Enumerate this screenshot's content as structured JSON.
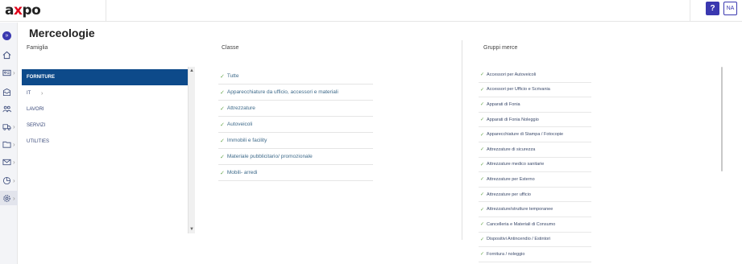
{
  "header": {
    "logo_a": "a",
    "logo_x": "x",
    "logo_po": "po",
    "help_label": "?",
    "user_initials": "NA"
  },
  "page": {
    "title": "Merceologie"
  },
  "columns": {
    "famiglia": "Famiglia",
    "classe": "Classe",
    "gruppi": "Gruppi merce"
  },
  "famiglia": [
    {
      "label": "FORNITURE",
      "selected": true
    },
    {
      "label": "IT"
    },
    {
      "label": "LAVORI"
    },
    {
      "label": "SERVIZI"
    },
    {
      "label": "UTILITIES"
    }
  ],
  "classe": [
    "Tutte",
    "Apparecchiature da ufficio, accessori e materiali",
    "Attrezzature",
    "Autoveicoli",
    "Immobili e facility",
    "Materiale pubblicitario/ promozionale",
    "Mobili- arredi"
  ],
  "gruppi": [
    "Accessori per Autoveicoli",
    "Accessori per Ufficio e Scrivania",
    "Apparati di Fonia",
    "Apparati di Fonia Noleggio",
    "Apparecchiature di Stampa / Fotocopie",
    "Attrezzature di sicurezza",
    "Attrezzature medico sanitarie",
    "Attrezzature per Esterno",
    "Attrezzature per ufficio",
    "Attrezzature/strutture temporanee",
    "Cancelleria e Materiali di Consumo",
    "Dispositivi Antincendio / Estintori",
    "Fornitura / noleggio"
  ],
  "colors": {
    "accent": "#3a38b0",
    "selected_bg": "#0d4a8a",
    "check": "#6aa84f",
    "logo_x": "#e2001a"
  },
  "icons": [
    "expand-icon",
    "home-icon",
    "id-card-icon",
    "inbox-icon",
    "people-icon",
    "truck-icon",
    "folder-icon",
    "mail-icon",
    "chart-icon",
    "gear-icon"
  ]
}
